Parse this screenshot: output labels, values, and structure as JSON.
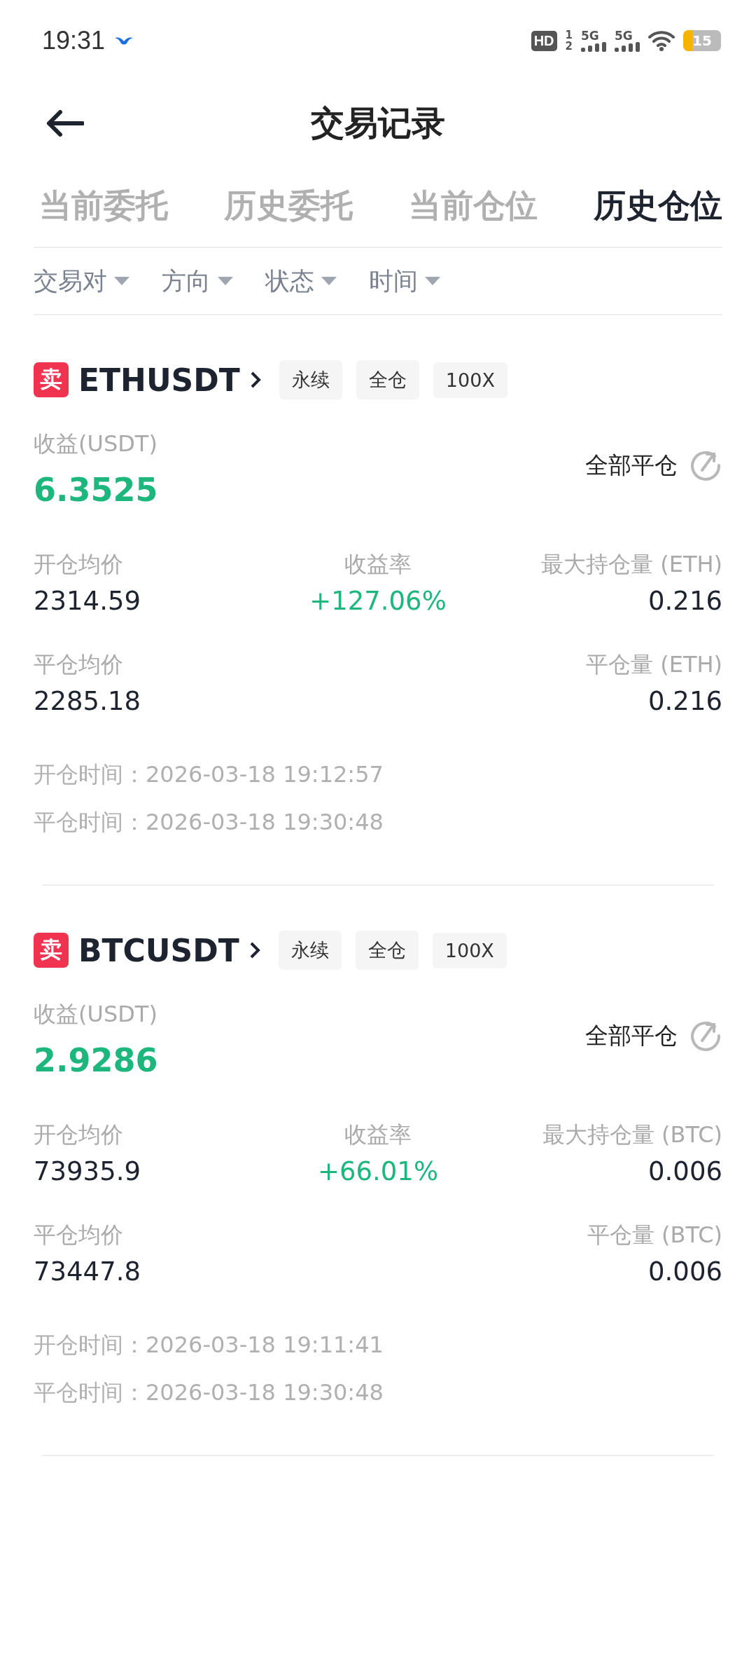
{
  "status_bar": {
    "time": "19:31",
    "hd_badge": "HD",
    "sim_slots": [
      "1",
      "2"
    ],
    "networks": [
      "5G",
      "5G"
    ],
    "battery": "15"
  },
  "header": {
    "title": "交易记录"
  },
  "tabs": [
    {
      "label": "当前委托",
      "selected": false
    },
    {
      "label": "历史委托",
      "selected": false
    },
    {
      "label": "当前仓位",
      "selected": false
    },
    {
      "label": "历史仓位",
      "selected": true
    }
  ],
  "filters": [
    "交易对",
    "方向",
    "状态",
    "时间"
  ],
  "positions": [
    {
      "side": {
        "label": "卖",
        "kind": "sell"
      },
      "symbol": "ETHUSDT",
      "tags": [
        "永续",
        "全仓",
        "100X"
      ],
      "pnl_label": "收益(USDT)",
      "pnl_value": "6.3525",
      "pnl_positive": true,
      "close_all": "全部平仓",
      "entry_price": {
        "label": "开仓均价",
        "value": "2314.59"
      },
      "pnl_rate": {
        "label": "收益率",
        "value": "+127.06%",
        "positive": true
      },
      "max_position": {
        "label": "最大持仓量 (ETH)",
        "value": "0.216"
      },
      "exit_price": {
        "label": "平仓均价",
        "value": "2285.18"
      },
      "closed_amount": {
        "label": "平仓量 (ETH)",
        "value": "0.216"
      },
      "open_time": {
        "label": "开仓时间：",
        "value": "2026-03-18 19:12:57"
      },
      "close_time": {
        "label": "平仓时间：",
        "value": "2026-03-18 19:30:48"
      }
    },
    {
      "side": {
        "label": "卖",
        "kind": "sell"
      },
      "symbol": "BTCUSDT",
      "tags": [
        "永续",
        "全仓",
        "100X"
      ],
      "pnl_label": "收益(USDT)",
      "pnl_value": "2.9286",
      "pnl_positive": true,
      "close_all": "全部平仓",
      "entry_price": {
        "label": "开仓均价",
        "value": "73935.9"
      },
      "pnl_rate": {
        "label": "收益率",
        "value": "+66.01%",
        "positive": true
      },
      "max_position": {
        "label": "最大持仓量 (BTC)",
        "value": "0.006"
      },
      "exit_price": {
        "label": "平仓均价",
        "value": "73447.8"
      },
      "closed_amount": {
        "label": "平仓量 (BTC)",
        "value": "0.006"
      },
      "open_time": {
        "label": "开仓时间：",
        "value": "2026-03-18 19:11:41"
      },
      "close_time": {
        "label": "平仓时间：",
        "value": "2026-03-18 19:30:48"
      }
    }
  ]
}
